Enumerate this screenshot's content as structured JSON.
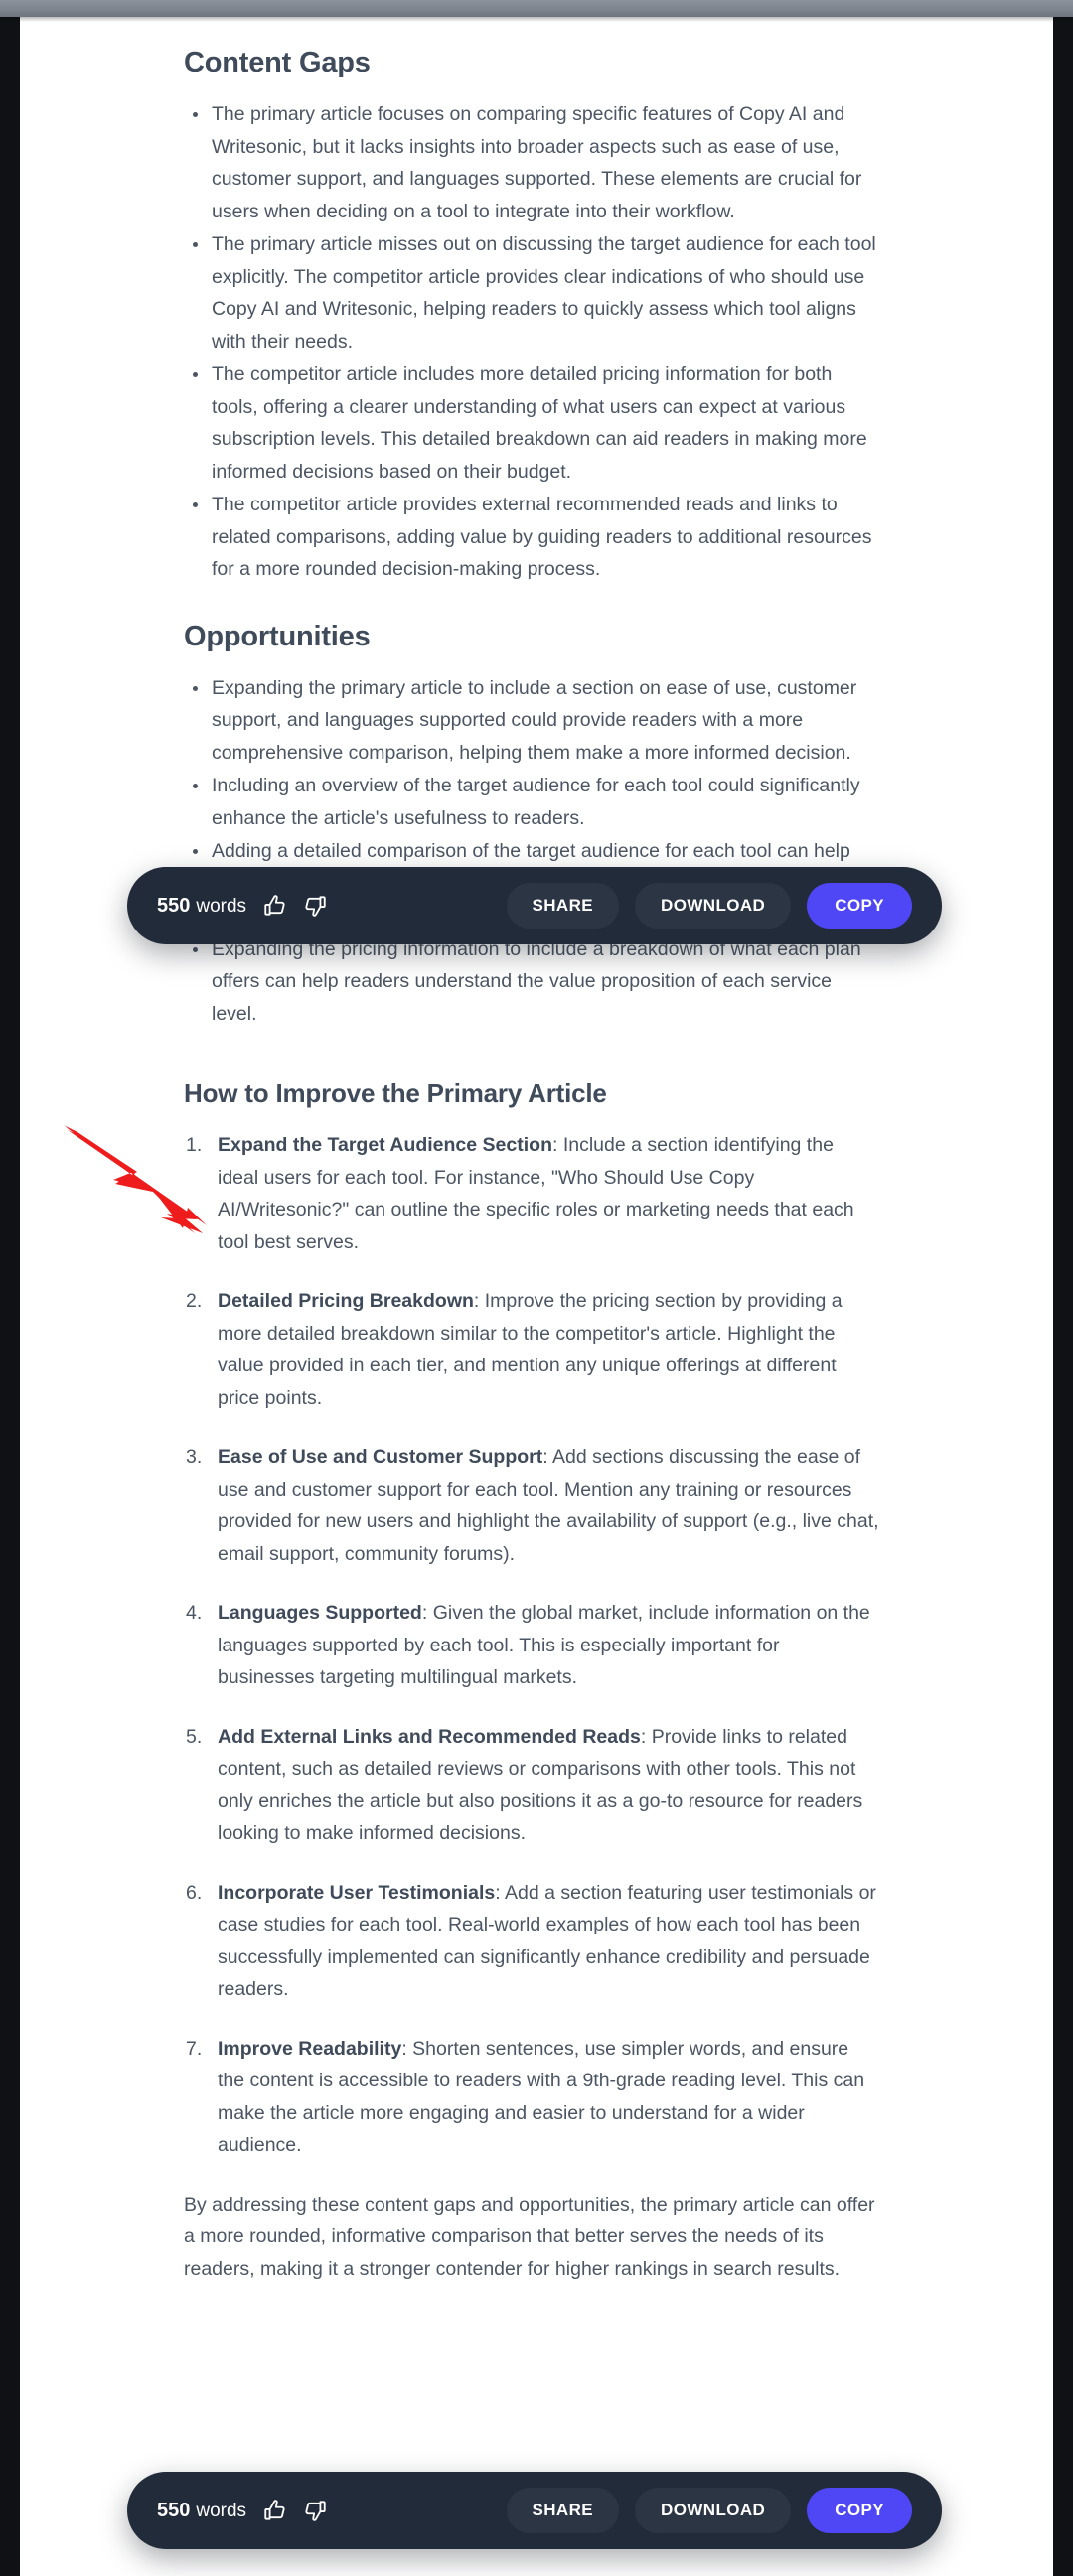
{
  "document": {
    "sections": [
      {
        "id": "content-gaps",
        "title": "Content Gaps",
        "bullets": [
          "The primary article focuses on comparing specific features of Copy AI and Writesonic, but it lacks insights into broader aspects such as ease of use, customer support, and languages supported. These elements are crucial for users when deciding on a tool to integrate into their workflow.",
          "The primary article misses out on discussing the target audience for each tool explicitly. The competitor article provides clear indications of who should use Copy AI and Writesonic, helping readers to quickly assess which tool aligns with their needs.",
          "The competitor article includes more detailed pricing information for both tools, offering a clearer understanding of what users can expect at various subscription levels. This detailed breakdown can aid readers in making more informed decisions based on their budget.",
          "The competitor article provides external recommended reads and links to related comparisons, adding value by guiding readers to additional resources for a more rounded decision-making process."
        ]
      },
      {
        "id": "opportunities",
        "title": "Opportunities",
        "bullets": [
          "Expanding the primary article to include a section on ease of use, customer support, and languages supported could provide readers with a more comprehensive comparison, helping them make a more informed decision.",
          "Including an overview of the target audience for each tool could significantly enhance the article's usefulness to readers.",
          "Adding a detailed comparison of the target audience for each tool can help readers quickly identify which tool is more suited to their specific needs, whether they are bloggers, social media marketers, or content writers.",
          "Expanding the pricing information to include a breakdown of what each plan offers can help readers understand the value proposition of each service level."
        ]
      }
    ],
    "improve": {
      "title": "How to Improve the Primary Article",
      "items": [
        {
          "lead": "Expand the Target Audience Section",
          "body": ": Include a section identifying the ideal users for each tool. For instance, \"Who Should Use Copy AI/Writesonic?\" can outline the specific roles or marketing needs that each tool best serves."
        },
        {
          "lead": "Detailed Pricing Breakdown",
          "body": ": Improve the pricing section by providing a more detailed breakdown similar to the competitor's article. Highlight the value provided in each tier, and mention any unique offerings at different price points."
        },
        {
          "lead": "Ease of Use and Customer Support",
          "body": ": Add sections discussing the ease of use and customer support for each tool. Mention any training or resources provided for new users and highlight the availability of support (e.g., live chat, email support, community forums)."
        },
        {
          "lead": "Languages Supported",
          "body": ": Given the global market, include information on the languages supported by each tool. This is especially important for businesses targeting multilingual markets."
        },
        {
          "lead": "Add External Links and Recommended Reads",
          "body": ": Provide links to related content, such as detailed reviews or comparisons with other tools. This not only enriches the article but also positions it as a go-to resource for readers looking to make informed decisions."
        },
        {
          "lead": "Incorporate User Testimonials",
          "body": ": Add a section featuring user testimonials or case studies for each tool. Real-world examples of how each tool has been successfully implemented can significantly enhance credibility and persuade readers."
        },
        {
          "lead": "Improve Readability",
          "body": ": Shorten sentences, use simpler words, and ensure the content is accessible to readers with a 9th-grade reading level. This can make the article more engaging and easier to understand for a wider audience."
        }
      ],
      "closing": "By addressing these content gaps and opportunities, the primary article can offer a more rounded, informative comparison that better serves the needs of its readers, making it a stronger contender for higher rankings in search results."
    }
  },
  "action_bar": {
    "word_count": "550",
    "word_unit": "words",
    "thumbs_up_icon": "thumbs-up-icon",
    "thumbs_down_icon": "thumbs-down-icon",
    "share_label": "SHARE",
    "download_label": "DOWNLOAD",
    "copy_label": "COPY"
  },
  "annotation": {
    "arrow_icon": "red-arrow-icon",
    "arrow_color": "#ee1c1c"
  },
  "theme": {
    "page_background": "#ffffff",
    "heading_color": "#3f4a5a",
    "body_color": "#4b5563",
    "toolbar_background": "#222b3a",
    "ghost_button_background": "#2b3544",
    "primary_button_background": "#4f46f5",
    "titlebar_color": "#7e848e"
  }
}
